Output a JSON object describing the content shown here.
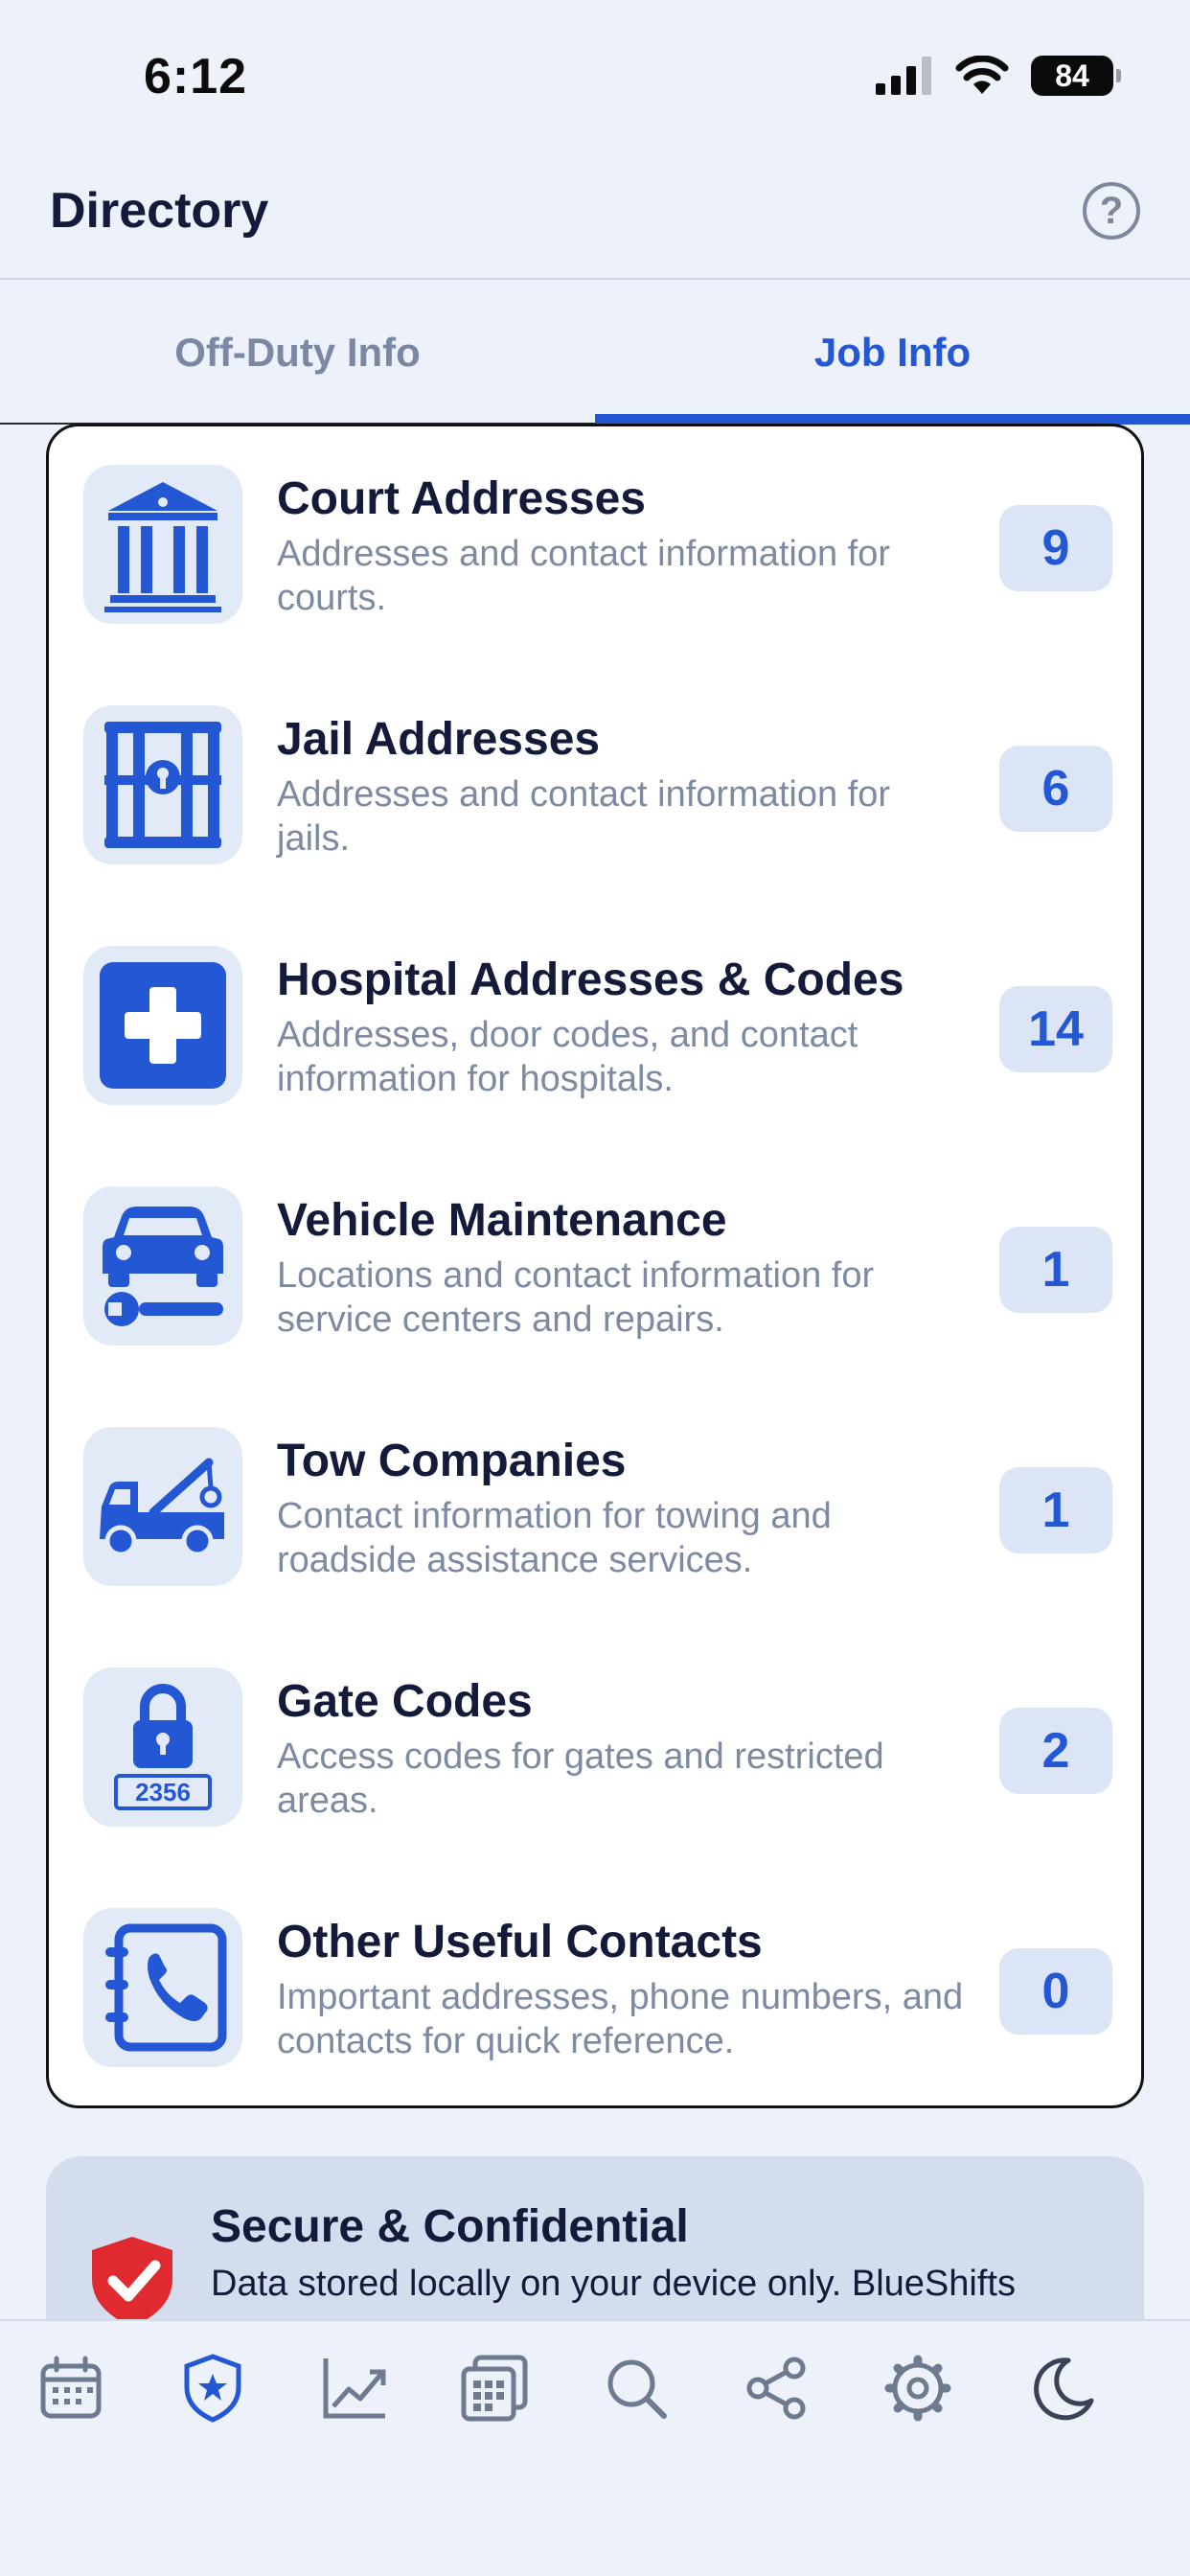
{
  "status_bar": {
    "time": "6:12",
    "battery": "84"
  },
  "header": {
    "title": "Directory",
    "help_symbol": "?"
  },
  "tabs": [
    {
      "label": "Off-Duty Info",
      "active": false
    },
    {
      "label": "Job Info",
      "active": true
    }
  ],
  "directory": [
    {
      "icon": "courthouse-icon",
      "title": "Court Addresses",
      "description": "Addresses and contact information for courts.",
      "count": "9"
    },
    {
      "icon": "jail-icon",
      "title": "Jail Addresses",
      "description": "Addresses and contact information for jails.",
      "count": "6"
    },
    {
      "icon": "hospital-icon",
      "title": "Hospital Addresses & Codes",
      "description": "Addresses, door codes, and contact information for hospitals.",
      "count": "14"
    },
    {
      "icon": "car-wrench-icon",
      "title": "Vehicle Maintenance",
      "description": "Locations and contact information for service centers and repairs.",
      "count": "1"
    },
    {
      "icon": "tow-truck-icon",
      "title": "Tow Companies",
      "description": "Contact information for towing and roadside assistance services.",
      "count": "1"
    },
    {
      "icon": "padlock-code-icon",
      "title": "Gate Codes",
      "description": "Access codes for gates and restricted areas.",
      "count": "2",
      "icon_text": "2356"
    },
    {
      "icon": "phone-book-icon",
      "title": "Other Useful Contacts",
      "description": "Important addresses, phone numbers, and contacts for quick reference.",
      "count": "0"
    }
  ],
  "secure_banner": {
    "icon": "shield-check-icon",
    "title": "Secure & Confidential",
    "text": "Data stored locally on your device only. BlueShifts"
  },
  "tab_bar": [
    {
      "icon": "calendar-icon",
      "active": false
    },
    {
      "icon": "badge-star-icon",
      "active": true
    },
    {
      "icon": "chart-line-icon",
      "active": false
    },
    {
      "icon": "pay-grid-icon",
      "active": false
    },
    {
      "icon": "search-icon",
      "active": false
    },
    {
      "icon": "share-icon",
      "active": false
    },
    {
      "icon": "gear-icon",
      "active": false
    },
    {
      "icon": "moon-icon",
      "active": false
    }
  ],
  "colors": {
    "accent": "#2357d3",
    "background": "#ecf1fa",
    "muted_text": "#7d8aa2",
    "shield_red": "#e02a2f"
  }
}
